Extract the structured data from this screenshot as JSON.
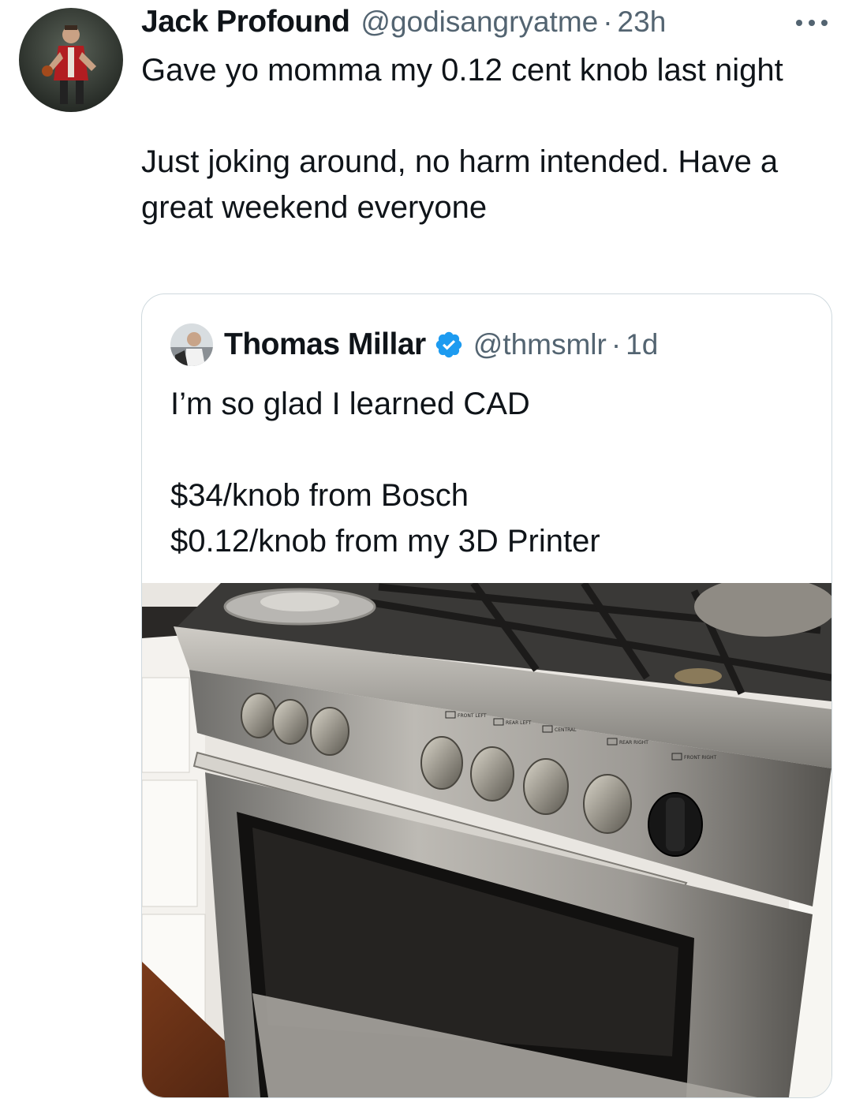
{
  "tweet": {
    "author_name": "Jack Profound",
    "author_handle": "@godisangryatme",
    "separator": "·",
    "time": "23h",
    "more_icon": "ellipsis-icon",
    "text_lines": [
      "Gave yo momma my 0.12 cent knob last night",
      "Just joking around, no harm intended. Have a great weekend everyone"
    ]
  },
  "quoted": {
    "author_name": "Thomas Millar",
    "verified_icon": "verified-badge-icon",
    "author_handle": "@thmsmlr",
    "separator": "·",
    "time": "1d",
    "text_lines": [
      "I’m so glad I learned CAD",
      "$34/knob from Bosch",
      "$0.12/knob from my 3D Printer"
    ],
    "media": {
      "dial_labels": [
        "FRONT LEFT",
        "REAR LEFT",
        "CENTRAL",
        "REAR RIGHT",
        "FRONT RIGHT"
      ]
    }
  },
  "colors": {
    "text_primary": "#0f1419",
    "text_secondary": "#536471",
    "border": "#cfd9de",
    "verified_blue": "#1d9bf0"
  }
}
